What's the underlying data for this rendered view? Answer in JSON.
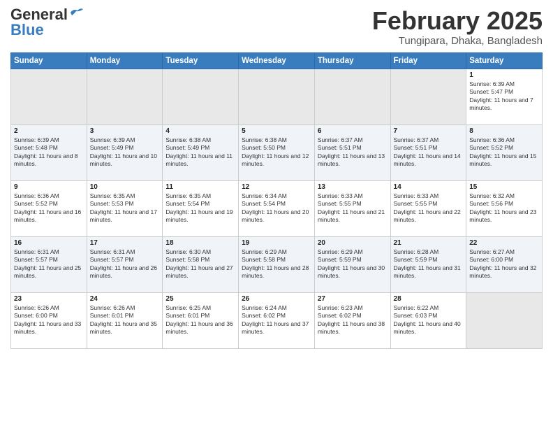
{
  "logo": {
    "line1": "General",
    "line2": "Blue"
  },
  "title": "February 2025",
  "location": "Tungipara, Dhaka, Bangladesh",
  "days_of_week": [
    "Sunday",
    "Monday",
    "Tuesday",
    "Wednesday",
    "Thursday",
    "Friday",
    "Saturday"
  ],
  "weeks": [
    [
      {
        "day": "",
        "info": ""
      },
      {
        "day": "",
        "info": ""
      },
      {
        "day": "",
        "info": ""
      },
      {
        "day": "",
        "info": ""
      },
      {
        "day": "",
        "info": ""
      },
      {
        "day": "",
        "info": ""
      },
      {
        "day": "1",
        "info": "Sunrise: 6:39 AM\nSunset: 5:47 PM\nDaylight: 11 hours and 7 minutes."
      }
    ],
    [
      {
        "day": "2",
        "info": "Sunrise: 6:39 AM\nSunset: 5:48 PM\nDaylight: 11 hours and 8 minutes."
      },
      {
        "day": "3",
        "info": "Sunrise: 6:39 AM\nSunset: 5:49 PM\nDaylight: 11 hours and 10 minutes."
      },
      {
        "day": "4",
        "info": "Sunrise: 6:38 AM\nSunset: 5:49 PM\nDaylight: 11 hours and 11 minutes."
      },
      {
        "day": "5",
        "info": "Sunrise: 6:38 AM\nSunset: 5:50 PM\nDaylight: 11 hours and 12 minutes."
      },
      {
        "day": "6",
        "info": "Sunrise: 6:37 AM\nSunset: 5:51 PM\nDaylight: 11 hours and 13 minutes."
      },
      {
        "day": "7",
        "info": "Sunrise: 6:37 AM\nSunset: 5:51 PM\nDaylight: 11 hours and 14 minutes."
      },
      {
        "day": "8",
        "info": "Sunrise: 6:36 AM\nSunset: 5:52 PM\nDaylight: 11 hours and 15 minutes."
      }
    ],
    [
      {
        "day": "9",
        "info": "Sunrise: 6:36 AM\nSunset: 5:52 PM\nDaylight: 11 hours and 16 minutes."
      },
      {
        "day": "10",
        "info": "Sunrise: 6:35 AM\nSunset: 5:53 PM\nDaylight: 11 hours and 17 minutes."
      },
      {
        "day": "11",
        "info": "Sunrise: 6:35 AM\nSunset: 5:54 PM\nDaylight: 11 hours and 19 minutes."
      },
      {
        "day": "12",
        "info": "Sunrise: 6:34 AM\nSunset: 5:54 PM\nDaylight: 11 hours and 20 minutes."
      },
      {
        "day": "13",
        "info": "Sunrise: 6:33 AM\nSunset: 5:55 PM\nDaylight: 11 hours and 21 minutes."
      },
      {
        "day": "14",
        "info": "Sunrise: 6:33 AM\nSunset: 5:55 PM\nDaylight: 11 hours and 22 minutes."
      },
      {
        "day": "15",
        "info": "Sunrise: 6:32 AM\nSunset: 5:56 PM\nDaylight: 11 hours and 23 minutes."
      }
    ],
    [
      {
        "day": "16",
        "info": "Sunrise: 6:31 AM\nSunset: 5:57 PM\nDaylight: 11 hours and 25 minutes."
      },
      {
        "day": "17",
        "info": "Sunrise: 6:31 AM\nSunset: 5:57 PM\nDaylight: 11 hours and 26 minutes."
      },
      {
        "day": "18",
        "info": "Sunrise: 6:30 AM\nSunset: 5:58 PM\nDaylight: 11 hours and 27 minutes."
      },
      {
        "day": "19",
        "info": "Sunrise: 6:29 AM\nSunset: 5:58 PM\nDaylight: 11 hours and 28 minutes."
      },
      {
        "day": "20",
        "info": "Sunrise: 6:29 AM\nSunset: 5:59 PM\nDaylight: 11 hours and 30 minutes."
      },
      {
        "day": "21",
        "info": "Sunrise: 6:28 AM\nSunset: 5:59 PM\nDaylight: 11 hours and 31 minutes."
      },
      {
        "day": "22",
        "info": "Sunrise: 6:27 AM\nSunset: 6:00 PM\nDaylight: 11 hours and 32 minutes."
      }
    ],
    [
      {
        "day": "23",
        "info": "Sunrise: 6:26 AM\nSunset: 6:00 PM\nDaylight: 11 hours and 33 minutes."
      },
      {
        "day": "24",
        "info": "Sunrise: 6:26 AM\nSunset: 6:01 PM\nDaylight: 11 hours and 35 minutes."
      },
      {
        "day": "25",
        "info": "Sunrise: 6:25 AM\nSunset: 6:01 PM\nDaylight: 11 hours and 36 minutes."
      },
      {
        "day": "26",
        "info": "Sunrise: 6:24 AM\nSunset: 6:02 PM\nDaylight: 11 hours and 37 minutes."
      },
      {
        "day": "27",
        "info": "Sunrise: 6:23 AM\nSunset: 6:02 PM\nDaylight: 11 hours and 38 minutes."
      },
      {
        "day": "28",
        "info": "Sunrise: 6:22 AM\nSunset: 6:03 PM\nDaylight: 11 hours and 40 minutes."
      },
      {
        "day": "",
        "info": ""
      }
    ]
  ]
}
